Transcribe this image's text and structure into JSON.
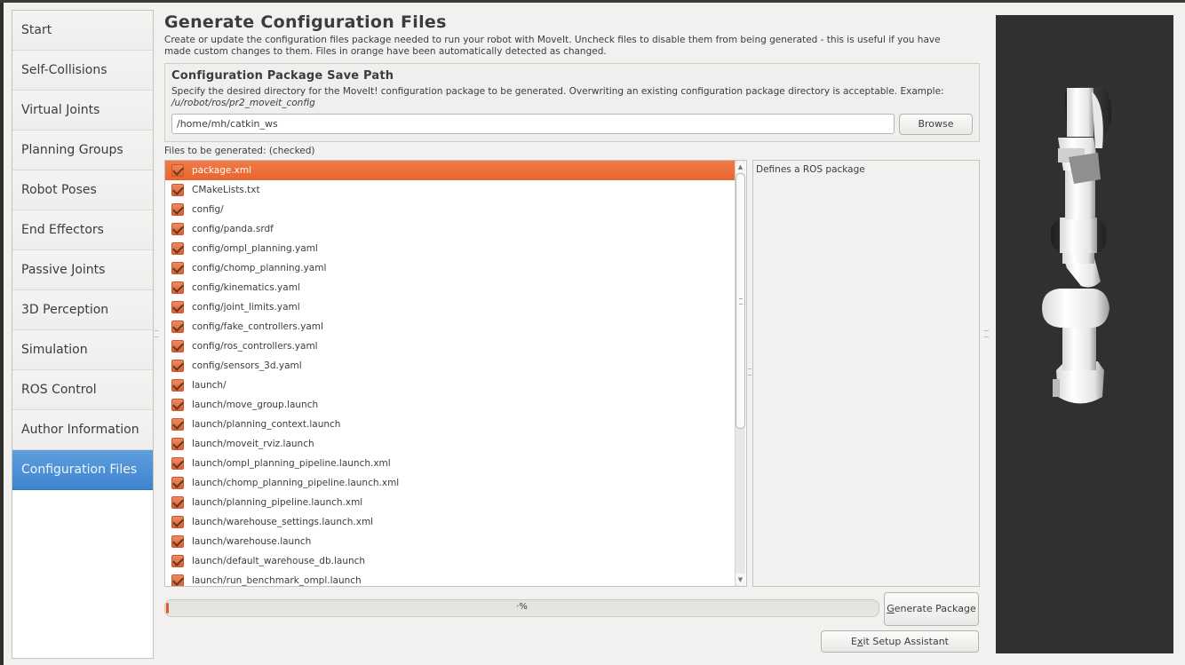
{
  "sidebar": {
    "items": [
      {
        "label": "Start"
      },
      {
        "label": "Self-Collisions"
      },
      {
        "label": "Virtual Joints"
      },
      {
        "label": "Planning Groups"
      },
      {
        "label": "Robot Poses"
      },
      {
        "label": "End Effectors"
      },
      {
        "label": "Passive Joints"
      },
      {
        "label": "3D Perception"
      },
      {
        "label": "Simulation"
      },
      {
        "label": "ROS Control"
      },
      {
        "label": "Author Information"
      },
      {
        "label": "Configuration Files",
        "active": true
      }
    ]
  },
  "header": {
    "title": "Generate Configuration Files",
    "description": "Create or update the configuration files package needed to run your robot with MoveIt. Uncheck files to disable them from being generated - this is useful if you have made custom changes to them. Files in orange have been automatically detected as changed."
  },
  "save_path": {
    "title": "Configuration Package Save Path",
    "description": "Specify the desired directory for the MoveIt! configuration package to be generated. Overwriting an existing configuration package directory is acceptable. Example: ",
    "example": "/u/robot/ros/pr2_moveit_config",
    "value": "/home/mh/catkin_ws",
    "browse_label": "Browse"
  },
  "files": {
    "label": "Files to be generated: (checked)",
    "selected_index": 0,
    "items": [
      {
        "name": "package.xml",
        "checked": true
      },
      {
        "name": "CMakeLists.txt",
        "checked": true
      },
      {
        "name": "config/",
        "checked": true
      },
      {
        "name": "config/panda.srdf",
        "checked": true
      },
      {
        "name": "config/ompl_planning.yaml",
        "checked": true
      },
      {
        "name": "config/chomp_planning.yaml",
        "checked": true
      },
      {
        "name": "config/kinematics.yaml",
        "checked": true
      },
      {
        "name": "config/joint_limits.yaml",
        "checked": true
      },
      {
        "name": "config/fake_controllers.yaml",
        "checked": true
      },
      {
        "name": "config/ros_controllers.yaml",
        "checked": true
      },
      {
        "name": "config/sensors_3d.yaml",
        "checked": true
      },
      {
        "name": "launch/",
        "checked": true
      },
      {
        "name": "launch/move_group.launch",
        "checked": true
      },
      {
        "name": "launch/planning_context.launch",
        "checked": true
      },
      {
        "name": "launch/moveit_rviz.launch",
        "checked": true
      },
      {
        "name": "launch/ompl_planning_pipeline.launch.xml",
        "checked": true
      },
      {
        "name": "launch/chomp_planning_pipeline.launch.xml",
        "checked": true
      },
      {
        "name": "launch/planning_pipeline.launch.xml",
        "checked": true
      },
      {
        "name": "launch/warehouse_settings.launch.xml",
        "checked": true
      },
      {
        "name": "launch/warehouse.launch",
        "checked": true
      },
      {
        "name": "launch/default_warehouse_db.launch",
        "checked": true
      },
      {
        "name": "launch/run_benchmark_ompl.launch",
        "checked": true
      }
    ],
    "selected_description": "Defines a ROS package"
  },
  "progress": {
    "value_percent": 0,
    "text": "·%"
  },
  "buttons": {
    "generate": {
      "mnemonic": "G",
      "rest": "enerate Package"
    },
    "exit": {
      "before": "E",
      "mnemonic": "x",
      "rest": "it Setup Assistant"
    }
  },
  "colors": {
    "accent_orange": "#e9652f",
    "active_blue": "#4a8fd6",
    "viewport_bg": "#312f2f"
  },
  "viewport": {
    "content": "robot-arm-3d-model"
  }
}
